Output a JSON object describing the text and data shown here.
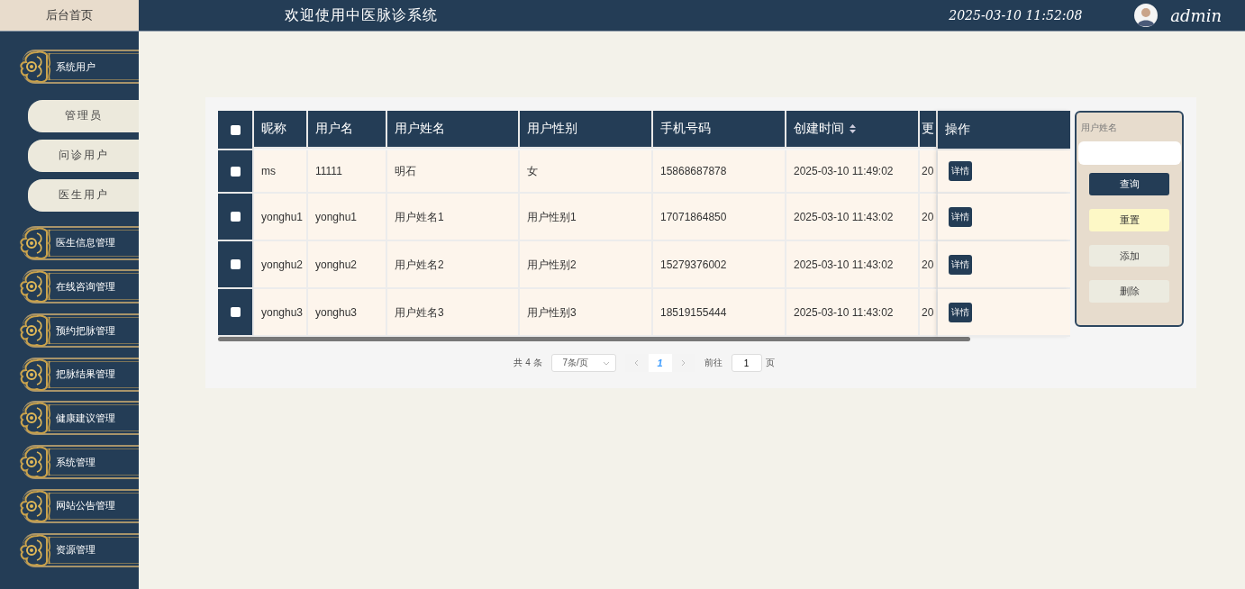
{
  "header": {
    "home": "后台首页",
    "title": "欢迎使用中医脉诊系统",
    "datetime": "2025-03-10 11:52:08",
    "user": "admin"
  },
  "sidebar": {
    "menu": [
      {
        "label": "系统用户",
        "children": [
          {
            "label": "管理员"
          },
          {
            "label": "问诊用户"
          },
          {
            "label": "医生用户"
          }
        ]
      },
      {
        "label": "医生信息管理"
      },
      {
        "label": "在线咨询管理"
      },
      {
        "label": "预约把脉管理"
      },
      {
        "label": "把脉结果管理"
      },
      {
        "label": "健康建议管理"
      },
      {
        "label": "系统管理"
      },
      {
        "label": "网站公告管理"
      },
      {
        "label": "资源管理"
      }
    ]
  },
  "table": {
    "select_all": {
      "checked": false
    },
    "columns": [
      {
        "label": "昵称"
      },
      {
        "label": "用户名"
      },
      {
        "label": "用户姓名"
      },
      {
        "label": "用户性别"
      },
      {
        "label": "手机号码"
      },
      {
        "label": "创建时间",
        "sortable": true
      },
      {
        "label": "更"
      }
    ],
    "action_column": "操作",
    "rows": [
      {
        "checked": false,
        "cells": [
          "ms",
          "11111",
          "明石",
          "女",
          "15868687878",
          "2025-03-10 11:49:02",
          "20"
        ],
        "action": "详情"
      },
      {
        "checked": false,
        "cells": [
          "yonghu1",
          "yonghu1",
          "用户姓名1",
          "用户性别1",
          "17071864850",
          "2025-03-10 11:43:02",
          "20"
        ],
        "action": "详情"
      },
      {
        "checked": false,
        "cells": [
          "yonghu2",
          "yonghu2",
          "用户姓名2",
          "用户性别2",
          "15279376002",
          "2025-03-10 11:43:02",
          "20"
        ],
        "action": "详情"
      },
      {
        "checked": false,
        "cells": [
          "yonghu3",
          "yonghu3",
          "用户姓名3",
          "用户性别3",
          "18519155444",
          "2025-03-10 11:43:02",
          "20"
        ],
        "action": "详情"
      }
    ]
  },
  "pagination": {
    "total": "共 4 条",
    "page_size": "7条/页",
    "pages": [
      {
        "label": "1",
        "selected": true
      }
    ],
    "goto_label": "前往",
    "goto_value": "1",
    "goto_suffix": "页"
  },
  "search": {
    "label": "用户姓名",
    "buttons": [
      {
        "label": "查询",
        "kind": "primary"
      },
      {
        "label": "重置",
        "kind": "warning"
      },
      {
        "label": "添加",
        "kind": "plain"
      },
      {
        "label": "删除",
        "kind": "plain"
      }
    ]
  }
}
